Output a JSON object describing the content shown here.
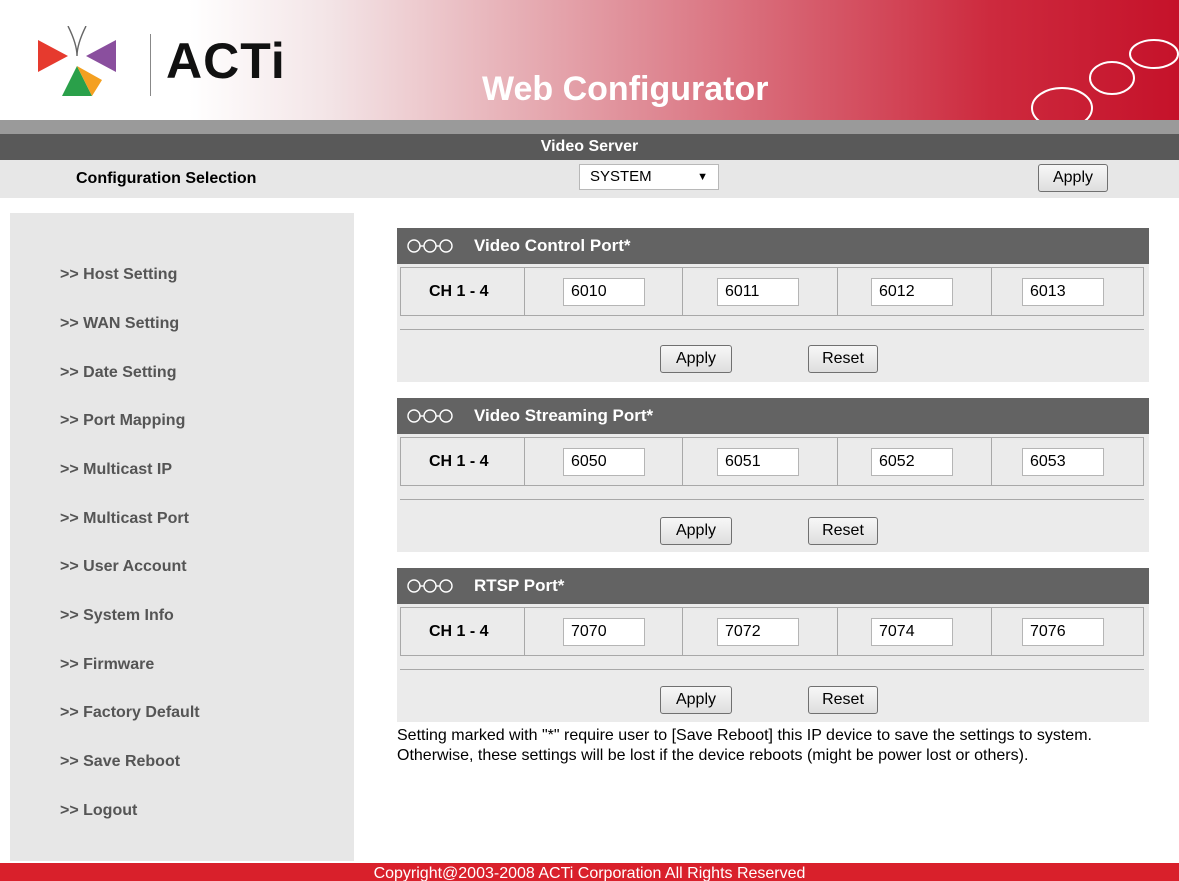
{
  "header": {
    "brand": "ACTi",
    "app_title": "Web Configurator",
    "subtitle": "Video Server",
    "colors": {
      "brand_red": "#c5122a",
      "logo_red": "#e63a2e",
      "logo_purple": "#8a4f9e",
      "logo_green": "#2aa04a",
      "logo_orange": "#f4a020"
    }
  },
  "config": {
    "label": "Configuration Selection",
    "selected": "SYSTEM",
    "apply_label": "Apply"
  },
  "sidebar": {
    "items": [
      ">> Host Setting",
      ">> WAN Setting",
      ">> Date Setting",
      ">> Port Mapping",
      ">> Multicast IP",
      ">> Multicast Port",
      ">> User Account",
      ">> System Info",
      ">> Firmware",
      ">> Factory Default",
      ">> Save Reboot",
      ">> Logout"
    ]
  },
  "panels": [
    {
      "title": "Video Control Port*",
      "channel": "CH 1 - 4",
      "ports": [
        "6010",
        "6011",
        "6012",
        "6013"
      ],
      "apply_label": "Apply",
      "reset_label": "Reset"
    },
    {
      "title": "Video Streaming Port*",
      "channel": "CH 1 - 4",
      "ports": [
        "6050",
        "6051",
        "6052",
        "6053"
      ],
      "apply_label": "Apply",
      "reset_label": "Reset"
    },
    {
      "title": "RTSP Port*",
      "channel": "CH 1 - 4",
      "ports": [
        "7070",
        "7072",
        "7074",
        "7076"
      ],
      "apply_label": "Apply",
      "reset_label": "Reset"
    }
  ],
  "note": "Setting marked with \"*\" require user to [Save Reboot] this IP device to save the settings to system. Otherwise, these settings will be lost if the device reboots (might be power lost or others).",
  "footer": {
    "copyright": "Copyright@2003-2008 ACTi Corporation All Rights Reserved"
  }
}
